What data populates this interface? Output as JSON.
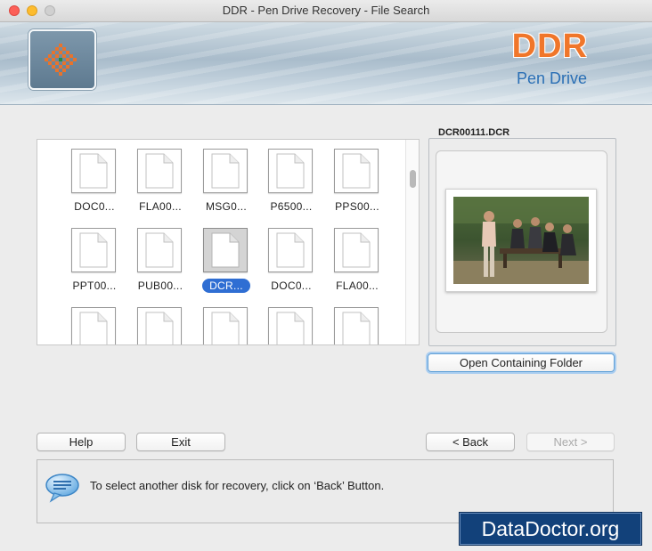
{
  "window": {
    "title": "DDR - Pen Drive Recovery - File Search"
  },
  "banner": {
    "brand": "DDR",
    "subtitle": "Pen Drive",
    "logo_icon": "checkered-logo-icon"
  },
  "files": [
    {
      "label": "DOC0..."
    },
    {
      "label": "FLA00..."
    },
    {
      "label": "MSG0..."
    },
    {
      "label": "P6500..."
    },
    {
      "label": "PPS00..."
    },
    {
      "label": "PPT00..."
    },
    {
      "label": "PUB00..."
    },
    {
      "label": "DCR...",
      "selected": true
    },
    {
      "label": "DOC0..."
    },
    {
      "label": "FLA00..."
    },
    {
      "label": ""
    },
    {
      "label": ""
    },
    {
      "label": ""
    },
    {
      "label": ""
    },
    {
      "label": ""
    }
  ],
  "preview": {
    "filename": "DCR00111.DCR",
    "open_folder_label": "Open Containing Folder"
  },
  "buttons": {
    "help": "Help",
    "exit": "Exit",
    "back": "< Back",
    "next": "Next >"
  },
  "status": {
    "message": "To select another disk for recovery, click on ‘Back’ Button."
  },
  "watermark": "DataDoctor.org",
  "colors": {
    "brand_orange": "#f0762a",
    "brand_blue": "#2a6fb5",
    "selection": "#2f6ed3",
    "watermark_bg": "#12417a"
  }
}
